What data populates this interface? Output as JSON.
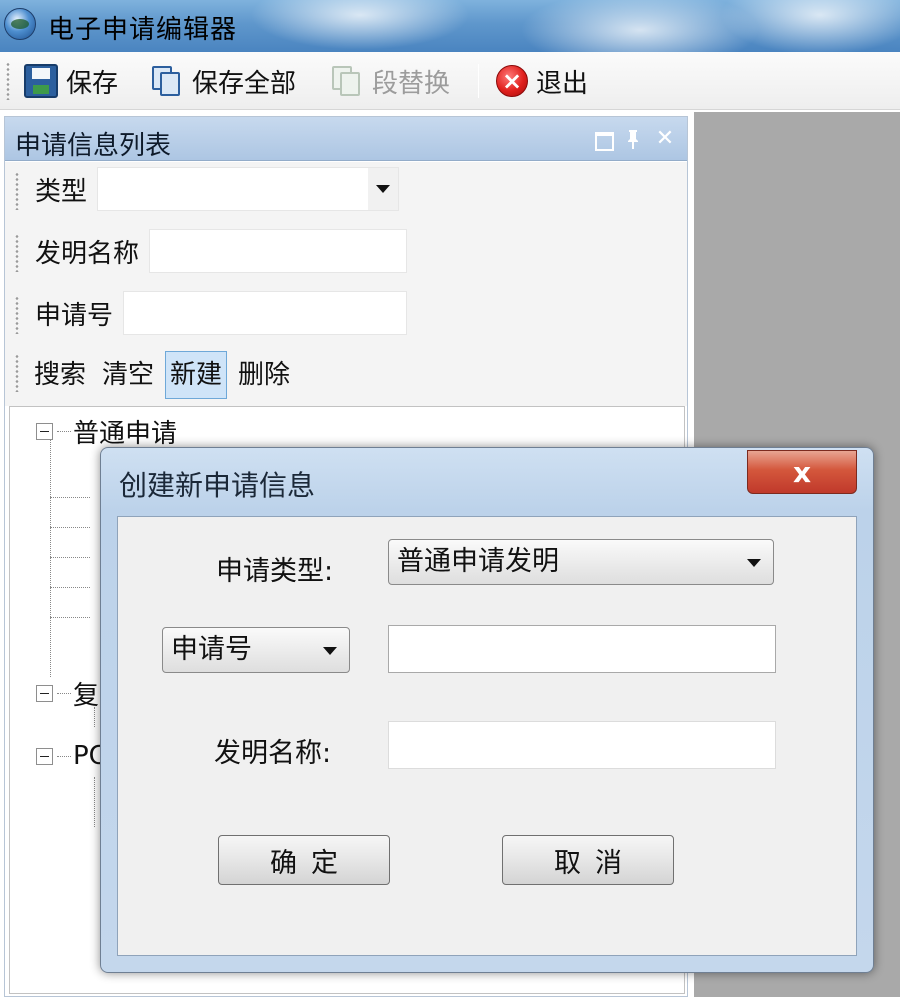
{
  "window": {
    "title": "电子申请编辑器"
  },
  "toolbar": {
    "items": [
      {
        "label": "保存",
        "icon": "save-icon",
        "enabled": true
      },
      {
        "label": "保存全部",
        "icon": "save-all-icon",
        "enabled": true
      },
      {
        "label": "段替换",
        "icon": "paragraph-replace-icon",
        "enabled": false
      },
      {
        "label": "退出",
        "icon": "exit-icon",
        "enabled": true
      }
    ]
  },
  "left_panel": {
    "title": "申请信息列表",
    "header_buttons": [
      "maximize-icon",
      "pin-icon",
      "close-icon"
    ],
    "filters": {
      "type_label": "类型",
      "type_value": "",
      "invention_name_label": "发明名称",
      "invention_name_value": "",
      "application_no_label": "申请号",
      "application_no_value": ""
    },
    "buttons": {
      "search": "搜索",
      "clear": "清空",
      "new": "新建",
      "delete": "删除"
    },
    "tree": {
      "nodes": [
        {
          "label": "普通申请",
          "expanded": true
        },
        {
          "label": "复",
          "expanded": true
        },
        {
          "label": "PC",
          "expanded": true
        }
      ]
    }
  },
  "dialog": {
    "title": "创建新申请信息",
    "close_label": "x",
    "application_type_label": "申请类型:",
    "application_type_value": "普通申请发明",
    "number_type_value": "申请号",
    "number_value": "",
    "invention_name_label": "发明名称:",
    "invention_name_value": "",
    "ok_label": "确定",
    "cancel_label": "取消"
  },
  "colors": {
    "titlebar": "#5f97cc",
    "panel_header": "#adc6e3",
    "active_button": "#cfe4f8",
    "right_pane": "#a9a9a9",
    "exit_icon": "#e0201d",
    "dialog_close": "#c0392b"
  }
}
